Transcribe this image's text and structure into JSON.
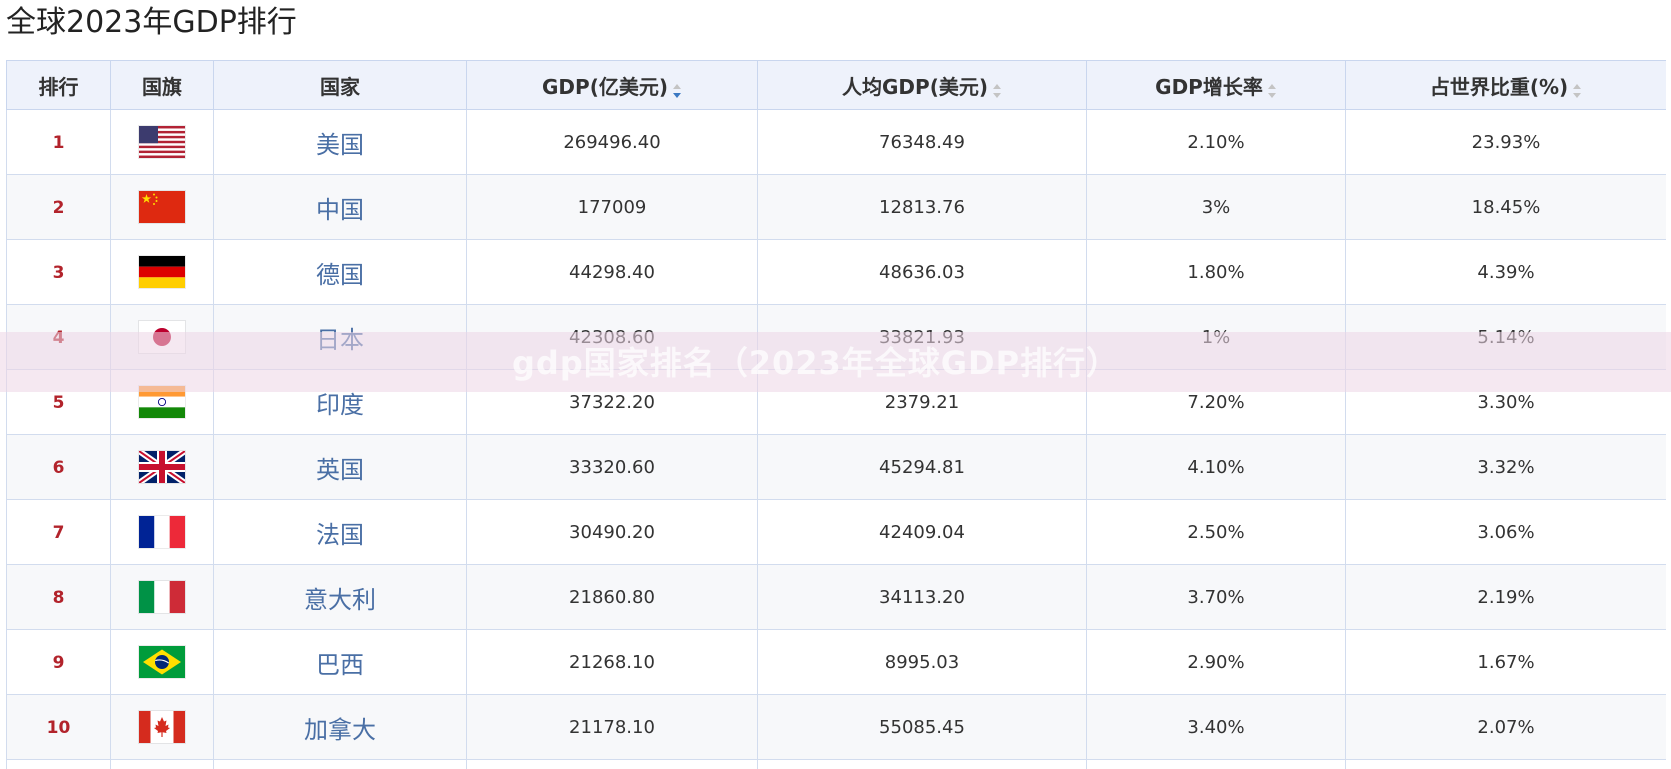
{
  "page": {
    "title": "全球2023年GDP排行"
  },
  "table": {
    "headers": {
      "rank": "排行",
      "flag": "国旗",
      "country": "国家",
      "gdp": "GDP(亿美元)",
      "per_capita": "人均GDP(美元)",
      "growth": "GDP增长率",
      "share": "占世界比重(%)"
    },
    "sort_state": {
      "gdp": "descending",
      "per_capita": "none",
      "growth": "none",
      "share": "none"
    },
    "rows": [
      {
        "rank": "1",
        "flag": "us-flag-icon",
        "country": "美国",
        "gdp": "269496.40",
        "per_capita": "76348.49",
        "growth": "2.10%",
        "share": "23.93%"
      },
      {
        "rank": "2",
        "flag": "cn-flag-icon",
        "country": "中国",
        "gdp": "177009",
        "per_capita": "12813.76",
        "growth": "3%",
        "share": "18.45%"
      },
      {
        "rank": "3",
        "flag": "de-flag-icon",
        "country": "德国",
        "gdp": "44298.40",
        "per_capita": "48636.03",
        "growth": "1.80%",
        "share": "4.39%"
      },
      {
        "rank": "4",
        "flag": "jp-flag-icon",
        "country": "日本",
        "gdp": "42308.60",
        "per_capita": "33821.93",
        "growth": "1%",
        "share": "5.14%"
      },
      {
        "rank": "5",
        "flag": "in-flag-icon",
        "country": "印度",
        "gdp": "37322.20",
        "per_capita": "2379.21",
        "growth": "7.20%",
        "share": "3.30%"
      },
      {
        "rank": "6",
        "flag": "gb-flag-icon",
        "country": "英国",
        "gdp": "33320.60",
        "per_capita": "45294.81",
        "growth": "4.10%",
        "share": "3.32%"
      },
      {
        "rank": "7",
        "flag": "fr-flag-icon",
        "country": "法国",
        "gdp": "30490.20",
        "per_capita": "42409.04",
        "growth": "2.50%",
        "share": "3.06%"
      },
      {
        "rank": "8",
        "flag": "it-flag-icon",
        "country": "意大利",
        "gdp": "21860.80",
        "per_capita": "34113.20",
        "growth": "3.70%",
        "share": "2.19%"
      },
      {
        "rank": "9",
        "flag": "br-flag-icon",
        "country": "巴西",
        "gdp": "21268.10",
        "per_capita": "8995.03",
        "growth": "2.90%",
        "share": "1.67%"
      },
      {
        "rank": "10",
        "flag": "ca-flag-icon",
        "country": "加拿大",
        "gdp": "21178.10",
        "per_capita": "55085.45",
        "growth": "3.40%",
        "share": "2.07%"
      }
    ]
  },
  "watermark": {
    "text": "gdp国家排名（2023年全球GDP排行）"
  },
  "colors": {
    "rank_red": "#b2232b",
    "country_link": "#4a6fa5",
    "header_bg": "#eef2fb",
    "border": "#d2dcee",
    "sort_active": "#3a78c2",
    "sort_inactive": "#c4c4c4"
  }
}
